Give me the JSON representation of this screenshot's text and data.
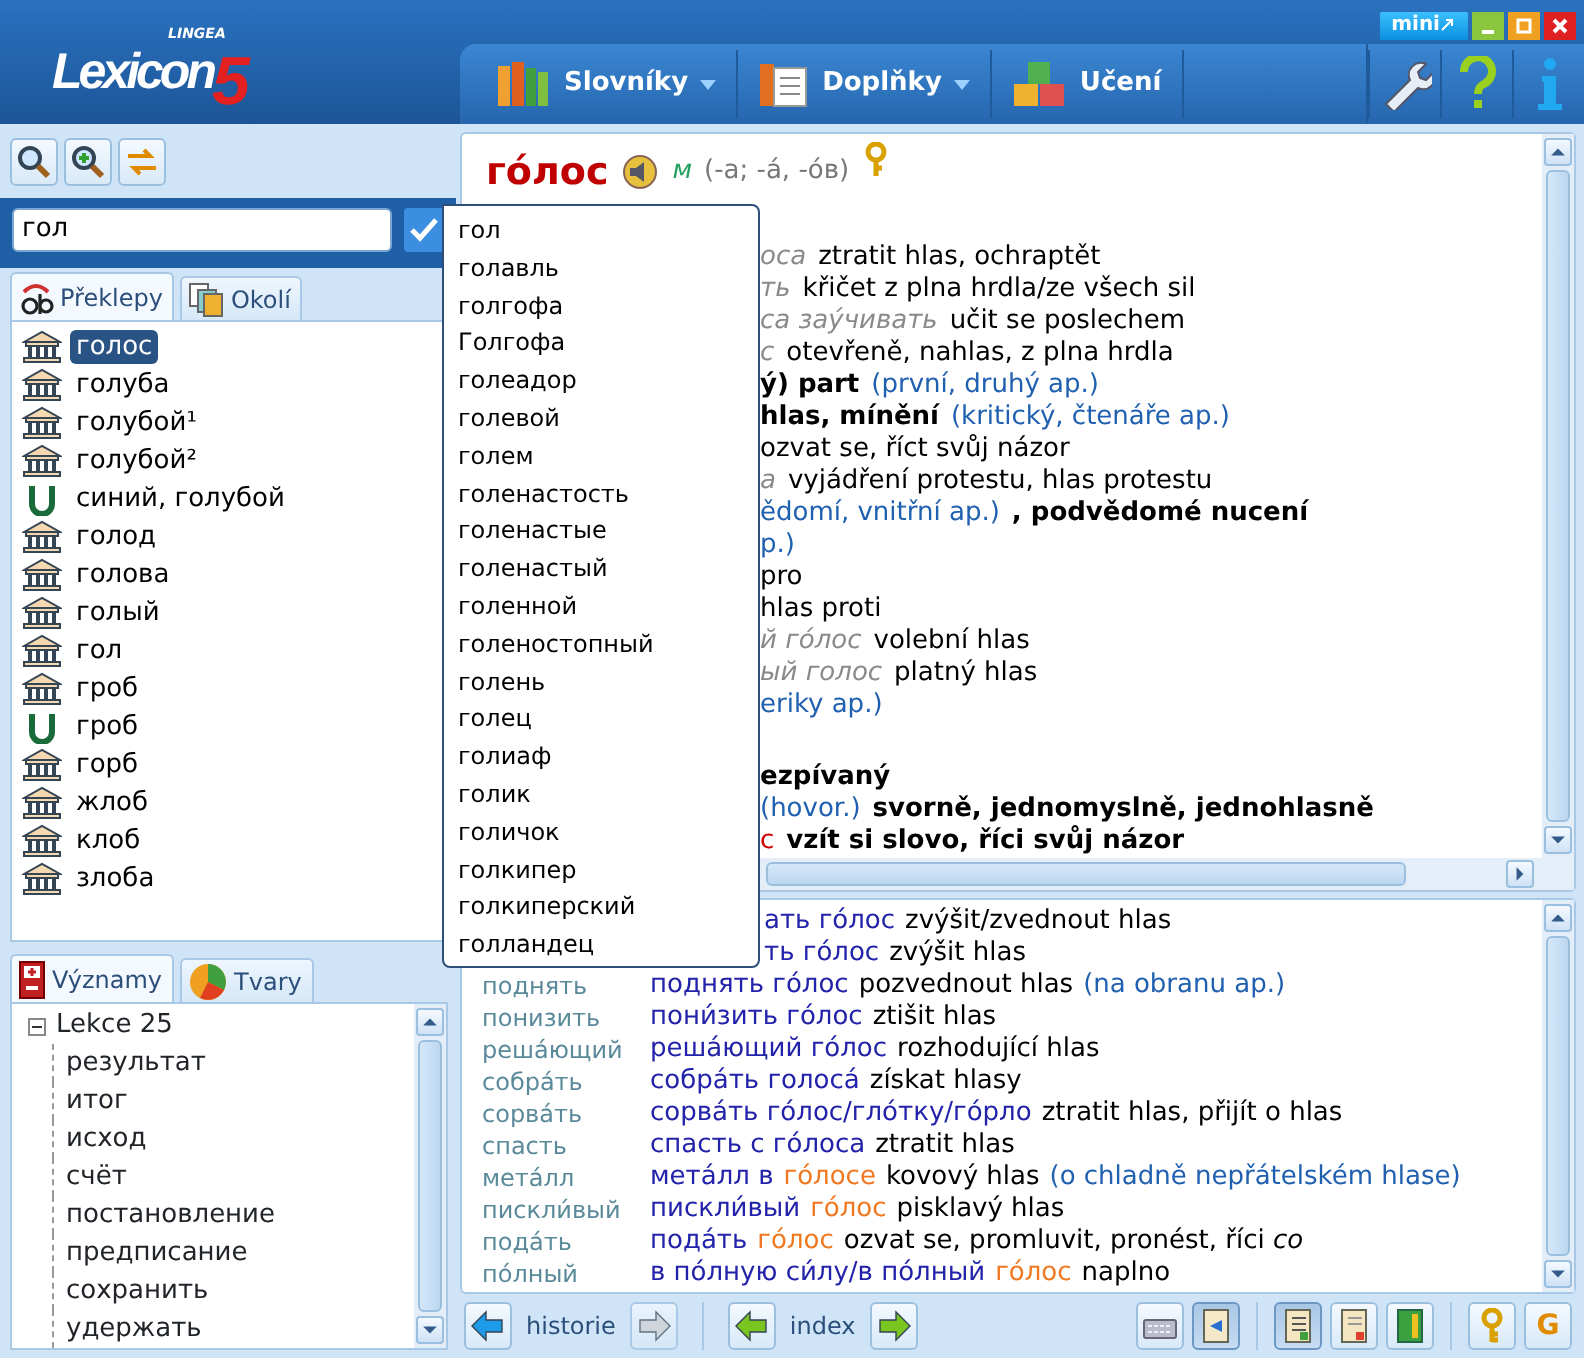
{
  "window": {
    "logo_brand": "LINGEA",
    "logo_name": "Lexicon",
    "logo_version": "5",
    "mini_button": "mini"
  },
  "menu": [
    {
      "label": "Slovníky",
      "dropdown": true
    },
    {
      "label": "Doplňky",
      "dropdown": true
    },
    {
      "label": "Učení",
      "dropdown": false
    }
  ],
  "search": {
    "value": "гол"
  },
  "word_tabs": [
    {
      "label": "Překlepy",
      "selected": true
    },
    {
      "label": "Okolí",
      "selected": false
    }
  ],
  "words": [
    {
      "text": "голос",
      "kind": "dictionary",
      "selected": true
    },
    {
      "text": "голуба",
      "kind": "dictionary",
      "selected": false
    },
    {
      "text": "голубой¹",
      "kind": "dictionary",
      "selected": false
    },
    {
      "text": "голубой²",
      "kind": "dictionary",
      "selected": false
    },
    {
      "text": "синий, голубой",
      "kind": "user",
      "selected": false
    },
    {
      "text": "голод",
      "kind": "dictionary",
      "selected": false
    },
    {
      "text": "голова",
      "kind": "dictionary",
      "selected": false
    },
    {
      "text": "голый",
      "kind": "dictionary",
      "selected": false
    },
    {
      "text": "гол",
      "kind": "dictionary",
      "selected": false
    },
    {
      "text": "гроб",
      "kind": "dictionary",
      "selected": false
    },
    {
      "text": "гроб",
      "kind": "user",
      "selected": false
    },
    {
      "text": "горб",
      "kind": "dictionary",
      "selected": false
    },
    {
      "text": "жлоб",
      "kind": "dictionary",
      "selected": false
    },
    {
      "text": "клоб",
      "kind": "dictionary",
      "selected": false
    },
    {
      "text": "злоба",
      "kind": "dictionary",
      "selected": false
    }
  ],
  "suggestions": [
    "гол",
    "голавль",
    "голгофа",
    "Голгофа",
    "голеадор",
    "голевой",
    "голем",
    "голенастость",
    "голенастые",
    "голенастый",
    "голенной",
    "голеностопный",
    "голень",
    "голец",
    "голиаф",
    "голик",
    "голичок",
    "голкипер",
    "голкиперский",
    "голландец"
  ],
  "lesson_tabs": [
    {
      "label": "Významy",
      "selected": true
    },
    {
      "label": "Tvary",
      "selected": false
    }
  ],
  "lesson_tree": [
    {
      "label": "Lekce 25",
      "expanded": true,
      "children": [
        {
          "label": "результат"
        },
        {
          "label": "итог"
        },
        {
          "label": "исход"
        },
        {
          "label": "счёт"
        },
        {
          "label": "постановление"
        },
        {
          "label": "предписание"
        },
        {
          "label": "сохранить"
        },
        {
          "label": "удержать"
        }
      ]
    }
  ],
  "entry": {
    "headword": "го́лос",
    "gender": "м",
    "forms": "(-а; -а́, -о́в)",
    "lines": [
      {
        "kind": "line",
        "parts": [
          {
            "kind": "example",
            "text": "оса"
          },
          {
            "kind": "text",
            "text": "ztratit hlas, ochraptět"
          }
        ]
      },
      {
        "kind": "line",
        "parts": [
          {
            "kind": "example",
            "text": "ть"
          },
          {
            "kind": "text",
            "text": "křičet z plna hrdla/ze všech sil"
          }
        ]
      },
      {
        "kind": "line",
        "parts": [
          {
            "kind": "example",
            "text": "са заýчивать"
          },
          {
            "kind": "text",
            "text": "učit se poslechem"
          }
        ]
      },
      {
        "kind": "line",
        "parts": [
          {
            "kind": "example",
            "text": "с"
          },
          {
            "kind": "text",
            "text": "otevřeně, nahlas, z plna hrdla"
          }
        ]
      },
      {
        "kind": "line",
        "parts": [
          {
            "kind": "bold",
            "text": "ý) part"
          },
          {
            "kind": "note",
            "text": "(první, druhý ap.)"
          }
        ]
      },
      {
        "kind": "line",
        "parts": [
          {
            "kind": "bold",
            "text": "hlas, mínění"
          },
          {
            "kind": "note",
            "text": "(kritický, čtenáře ap.)"
          }
        ]
      },
      {
        "kind": "line",
        "parts": [
          {
            "kind": "text",
            "text": "ozvat se, říct svůj názor"
          }
        ]
      },
      {
        "kind": "line",
        "parts": [
          {
            "kind": "example",
            "text": "а"
          },
          {
            "kind": "text",
            "text": "vyjádření protestu, hlas protestu"
          }
        ]
      },
      {
        "kind": "line",
        "parts": [
          {
            "kind": "note",
            "text": "ědomí, vnitřní ap.)"
          },
          {
            "kind": "bold",
            "text": ", podvědomé nucení"
          }
        ]
      },
      {
        "kind": "line",
        "parts": [
          {
            "kind": "note",
            "text": "p.)"
          }
        ]
      },
      {
        "kind": "line",
        "parts": [
          {
            "kind": "text",
            "text": "pro"
          }
        ]
      },
      {
        "kind": "line",
        "parts": [
          {
            "kind": "text",
            "text": "hlas proti"
          }
        ]
      },
      {
        "kind": "line",
        "parts": [
          {
            "kind": "example",
            "text": "й го́лос"
          },
          {
            "kind": "text",
            "text": "volební hlas"
          }
        ]
      },
      {
        "kind": "line",
        "parts": [
          {
            "kind": "example",
            "text": "ый голос"
          },
          {
            "kind": "text",
            "text": "platný hlas"
          }
        ]
      },
      {
        "kind": "line",
        "parts": [
          {
            "kind": "note",
            "text": "eriky ap.)"
          }
        ]
      },
      {
        "kind": "gap"
      },
      {
        "kind": "line",
        "parts": [
          {
            "kind": "bold",
            "text": "ezpívaný"
          }
        ]
      },
      {
        "kind": "line",
        "parts": [
          {
            "kind": "note",
            "text": "(hovor.)"
          },
          {
            "kind": "bold",
            "text": "svorně, jednomyslně, jednohlasně"
          }
        ]
      },
      {
        "kind": "line",
        "parts": [
          {
            "kind": "red",
            "text": "с"
          },
          {
            "kind": "bold",
            "text": "vzít si slovo, říci svůj názor"
          }
        ]
      }
    ]
  },
  "phrases": [
    {
      "kind": "covered",
      "parts": [
        {
          "kind": "phrase",
          "text": "ать го́лос"
        }
      ],
      "translation": "zvýšit/zvednout hlas"
    },
    {
      "kind": "covered",
      "parts": [
        {
          "kind": "phrase",
          "text": "ть го́лос"
        }
      ],
      "translation": "zvýšit hlas"
    },
    {
      "kind": "full",
      "key": "поднять",
      "parts": [
        {
          "kind": "phrase",
          "text": "поднять го́лос"
        }
      ],
      "translation": "pozvednout hlas",
      "note": "(na obranu ap.)"
    },
    {
      "kind": "full",
      "key": "понизить",
      "parts": [
        {
          "kind": "phrase",
          "text": "пони́зить го́лос"
        }
      ],
      "translation": "ztišit hlas"
    },
    {
      "kind": "full",
      "key": "реша́ющий",
      "parts": [
        {
          "kind": "phrase",
          "text": "реша́ющий го́лос"
        }
      ],
      "translation": "rozhodující hlas"
    },
    {
      "kind": "full",
      "key": "собра́ть",
      "parts": [
        {
          "kind": "phrase",
          "text": "собра́ть голоса́"
        }
      ],
      "translation": "získat hlasy"
    },
    {
      "kind": "full",
      "key": "сорва́ть",
      "parts": [
        {
          "kind": "phrase",
          "text": "сорва́ть го́лос/гло́тку/го́рло"
        }
      ],
      "translation": "ztratit hlas, přijít o hlas"
    },
    {
      "kind": "full",
      "key": "спасть",
      "parts": [
        {
          "kind": "phrase",
          "text": "спасть с го́лоса"
        }
      ],
      "translation": "ztratit hlas"
    },
    {
      "kind": "full",
      "key": "мета́лл",
      "parts": [
        {
          "kind": "phrase",
          "text": "мета́лл в"
        },
        {
          "kind": "head",
          "text": "го́лосе"
        }
      ],
      "translation": "kovový hlas",
      "note": "(o chladně nepřátelském hlase)"
    },
    {
      "kind": "full",
      "key": "пискли́вый",
      "parts": [
        {
          "kind": "phrase",
          "text": "пискли́вый"
        },
        {
          "kind": "head",
          "text": "го́лос"
        }
      ],
      "translation": "pisklavý hlas"
    },
    {
      "kind": "full",
      "key": "пода́ть",
      "parts": [
        {
          "kind": "phrase",
          "text": "пода́ть"
        },
        {
          "kind": "head",
          "text": "го́лос"
        }
      ],
      "translation": "ozvat se, promluvit, pronést, říci *co*"
    },
    {
      "kind": "full",
      "key": "по́лный",
      "parts": [
        {
          "kind": "phrase",
          "text": "в по́лную си́лу/в по́лный"
        },
        {
          "kind": "head",
          "text": "го́лос"
        }
      ],
      "translation": "naplno"
    }
  ],
  "bottom_toolbar": {
    "history_label": "historie",
    "history_back_enabled": true,
    "history_forward_enabled": false,
    "index_label": "index"
  },
  "view_buttons": [
    {
      "pressed": false
    },
    {
      "pressed": true
    },
    {
      "pressed": true
    },
    {
      "pressed": false
    },
    {
      "pressed": false
    },
    {
      "pressed": false
    },
    {
      "label": "G",
      "pressed": false
    }
  ]
}
